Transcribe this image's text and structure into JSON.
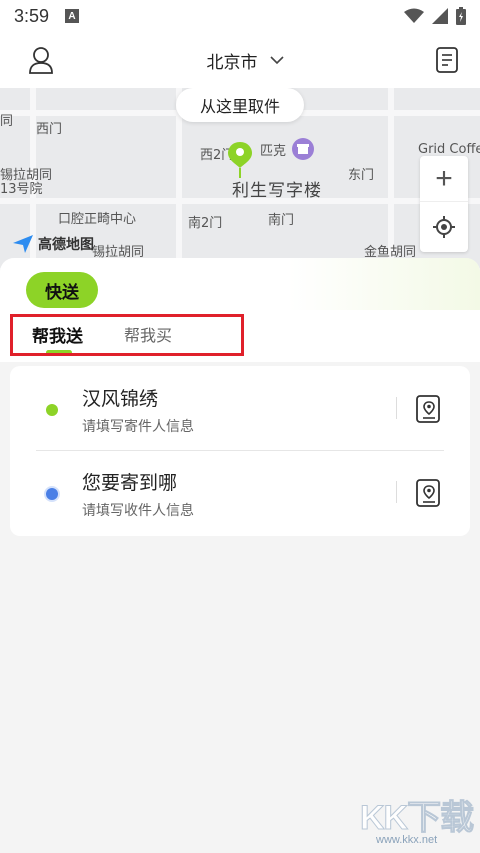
{
  "status_bar": {
    "time": "3:59",
    "notification_glyph": "A"
  },
  "header": {
    "city": "北京市"
  },
  "map": {
    "pickup_bubble": "从这里取件",
    "building_name": "利生写字楼",
    "brand": "高德地图",
    "labels": [
      "同",
      "西门",
      "西2门",
      "匹克",
      "东门",
      "Grid Coffe",
      "锡拉胡同",
      "13号院",
      "口腔正畸中心",
      "南2门",
      "南门",
      "锡拉胡同",
      "金鱼胡同"
    ]
  },
  "order_panel": {
    "service_tag": "快送",
    "tabs": [
      {
        "label": "帮我送",
        "active": true
      },
      {
        "label": "帮我买",
        "active": false
      }
    ],
    "sender": {
      "title": "汉风锦绣",
      "hint": "请填写寄件人信息",
      "dot_color": "#8dd327"
    },
    "receiver": {
      "title": "您要寄到哪",
      "hint": "请填写收件人信息",
      "dot_color": "#4a7fe6"
    }
  },
  "watermark": {
    "logo": "KK下载",
    "url": "www.kkx.net"
  }
}
